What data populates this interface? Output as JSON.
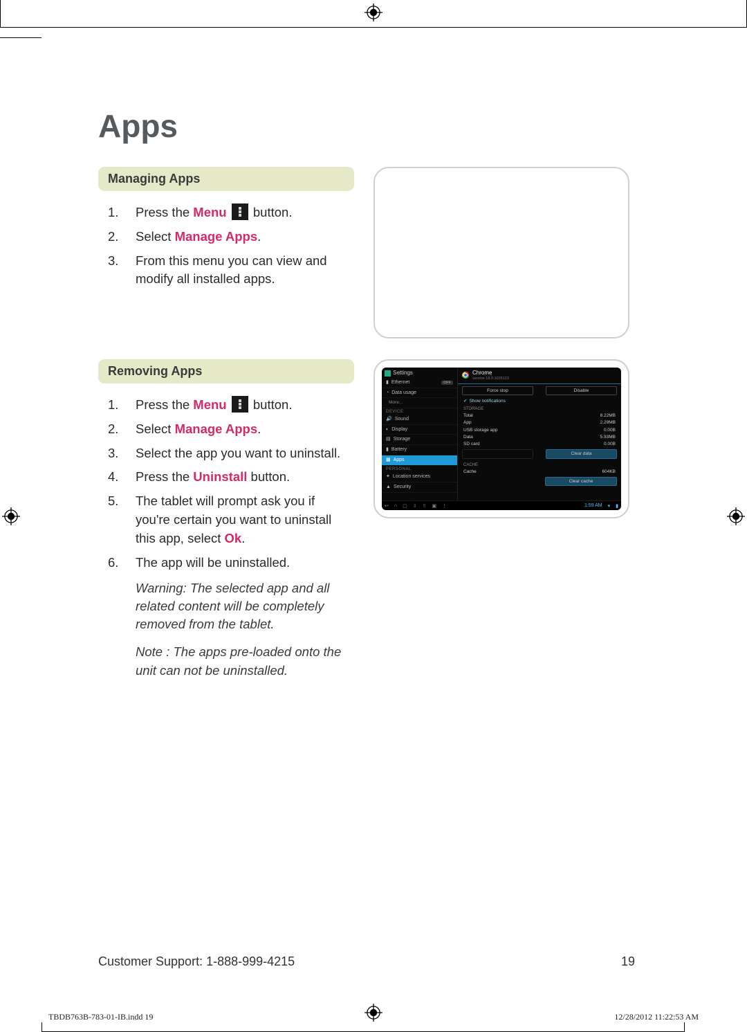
{
  "title": "Apps",
  "sections": {
    "managing": {
      "heading": "Managing Apps",
      "steps": [
        {
          "pre": "Press the ",
          "hl": "Menu",
          "icon": true,
          "post": "  button."
        },
        {
          "pre": "Select ",
          "hl": "Manage Apps",
          "post": "."
        },
        {
          "text": "From this menu you can view and modify all installed apps."
        }
      ]
    },
    "removing": {
      "heading": "Removing Apps",
      "steps": [
        {
          "pre": "Press the ",
          "hl": "Menu",
          "icon": true,
          "post": "  button."
        },
        {
          "pre": "Select ",
          "hl": "Manage Apps",
          "post": "."
        },
        {
          "text": "Select the app you want to uninstall."
        },
        {
          "pre": "Press the ",
          "hl": "Uninstall",
          "post": " button."
        },
        {
          "pre": "The tablet will prompt ask you if you're certain you want to uninstall this app, select ",
          "hl": "Ok",
          "post": "."
        },
        {
          "text": "The app will be uninstalled."
        }
      ],
      "notes": [
        "Warning: The selected app and all related content will be completely removed from the tablet.",
        "Note : The apps pre-loaded onto the unit can not be uninstalled."
      ]
    }
  },
  "tablet": {
    "settings_label": "Settings",
    "sidebar": [
      {
        "label": "Ethernet",
        "badge": "OFF"
      },
      {
        "label": "Data usage"
      }
    ],
    "more": "More...",
    "device_group": "DEVICE",
    "device_items": [
      {
        "label": "Sound"
      },
      {
        "label": "Display"
      },
      {
        "label": "Storage"
      },
      {
        "label": "Battery"
      },
      {
        "label": "Apps",
        "selected": true
      }
    ],
    "personal_group": "PERSONAL",
    "personal_items": [
      {
        "label": "Location services"
      },
      {
        "label": "Security"
      }
    ],
    "app": {
      "name": "Chrome",
      "version": "version 18.0.1025123",
      "force_stop": "Force stop",
      "disable": "Disable",
      "show_notifications": "Show notifications",
      "storage_label": "STORAGE",
      "rows": [
        {
          "k": "Total",
          "v": "8.22MB"
        },
        {
          "k": "App",
          "v": "2.29MB"
        },
        {
          "k": "USB storage app",
          "v": "0.00B"
        },
        {
          "k": "Data",
          "v": "5.93MB"
        },
        {
          "k": "SD card",
          "v": "0.00B"
        }
      ],
      "clear_data": "Clear data",
      "cache_label": "CACHE",
      "cache_row": {
        "k": "Cache",
        "v": "604KB"
      },
      "clear_cache": "Clear cache"
    },
    "time": "1:59 AM"
  },
  "footer": {
    "support": "Customer Support: 1-888-999-4215",
    "page_no": "19"
  },
  "indd": {
    "file": "TBDB763B-783-01-IB.indd   19",
    "stamp": "12/28/2012   11:22:53 AM"
  }
}
